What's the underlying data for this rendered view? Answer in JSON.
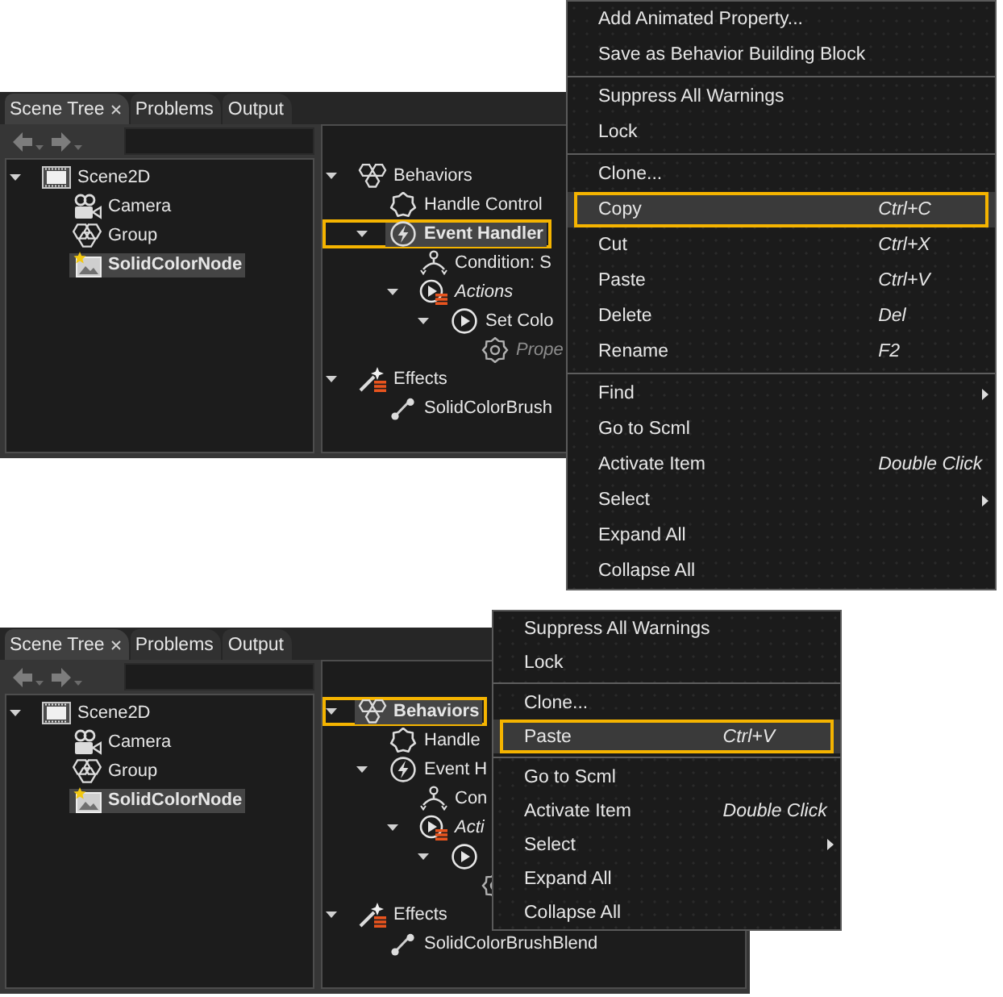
{
  "scenes": [
    {
      "tabs": [
        {
          "label": "Scene Tree",
          "selected": true,
          "closable": true
        },
        {
          "label": "Problems",
          "selected": false,
          "closable": false
        },
        {
          "label": "Output",
          "selected": false,
          "closable": false
        }
      ],
      "scene_tree": [
        {
          "kind": "scene",
          "label": "Scene2D",
          "selected": false,
          "outlined": false,
          "expanded": true,
          "children": [
            {
              "kind": "camera",
              "label": "Camera",
              "selected": false,
              "outlined": false
            },
            {
              "kind": "group",
              "label": "Group",
              "selected": false,
              "outlined": false
            },
            {
              "kind": "image_node",
              "label": "SolidColorNode",
              "selected": true,
              "outlined": false
            }
          ]
        }
      ],
      "behavior_tree": [
        {
          "kind": "behaviors",
          "label": "Behaviors",
          "selected": false,
          "outlined": false,
          "expanded": true,
          "children": [
            {
              "kind": "handle_control",
              "label": "Handle Control",
              "selected": false,
              "outlined": false
            },
            {
              "kind": "event_handler",
              "label": "Event Handler",
              "selected": true,
              "outlined": true,
              "expanded": true,
              "children": [
                {
                  "kind": "condition",
                  "label": "Condition: S",
                  "selected": false,
                  "outlined": false
                },
                {
                  "kind": "actions",
                  "label": "Actions",
                  "selected": false,
                  "outlined": false,
                  "expanded": true,
                  "children": [
                    {
                      "kind": "action",
                      "label": "Set Colo",
                      "selected": false,
                      "outlined": false,
                      "expanded": true,
                      "children": [
                        {
                          "kind": "property",
                          "label": "Prope",
                          "selected": false,
                          "outlined": false
                        }
                      ]
                    }
                  ]
                }
              ]
            }
          ]
        },
        {
          "kind": "effects",
          "label": "Effects",
          "selected": false,
          "outlined": false,
          "expanded": true,
          "children": [
            {
              "kind": "brush",
              "label": "SolidColorBrush",
              "selected": false,
              "outlined": false
            }
          ]
        }
      ],
      "context_menu": {
        "sections": [
          {
            "items": [
              {
                "label": "Add Animated Property...",
                "selected": false,
                "outlined": false,
                "submenu": false
              },
              {
                "label": "Save as Behavior Building Block",
                "selected": false,
                "outlined": false,
                "submenu": false
              }
            ]
          },
          {
            "items": [
              {
                "label": "Suppress All Warnings",
                "selected": false,
                "outlined": false,
                "submenu": false
              },
              {
                "label": "Lock",
                "selected": false,
                "outlined": false,
                "submenu": false
              }
            ]
          },
          {
            "items": [
              {
                "label": "Clone...",
                "selected": false,
                "outlined": false,
                "submenu": false
              },
              {
                "label": "Copy",
                "shortcut": "Ctrl+C",
                "selected": true,
                "outlined": true,
                "submenu": false
              },
              {
                "label": "Cut",
                "shortcut": "Ctrl+X",
                "selected": false,
                "outlined": false,
                "submenu": false
              },
              {
                "label": "Paste",
                "shortcut": "Ctrl+V",
                "selected": false,
                "outlined": false,
                "submenu": false
              },
              {
                "label": "Delete",
                "shortcut": "Del",
                "selected": false,
                "outlined": false,
                "submenu": false
              },
              {
                "label": "Rename",
                "shortcut": "F2",
                "selected": false,
                "outlined": false,
                "submenu": false
              }
            ]
          },
          {
            "items": [
              {
                "label": "Find",
                "selected": false,
                "outlined": false,
                "submenu": true
              },
              {
                "label": "Go to Scml",
                "selected": false,
                "outlined": false,
                "submenu": false
              },
              {
                "label": "Activate Item",
                "shortcut": "Double Click",
                "selected": false,
                "outlined": false,
                "submenu": false
              },
              {
                "label": "Select",
                "selected": false,
                "outlined": false,
                "submenu": true
              },
              {
                "label": "Expand All",
                "selected": false,
                "outlined": false,
                "submenu": false
              },
              {
                "label": "Collapse All",
                "selected": false,
                "outlined": false,
                "submenu": false
              }
            ]
          }
        ]
      }
    },
    {
      "tabs": [
        {
          "label": "Scene Tree",
          "selected": true,
          "closable": true
        },
        {
          "label": "Problems",
          "selected": false,
          "closable": false
        },
        {
          "label": "Output",
          "selected": false,
          "closable": false
        }
      ],
      "scene_tree": [
        {
          "kind": "scene",
          "label": "Scene2D",
          "selected": false,
          "outlined": false,
          "expanded": true,
          "children": [
            {
              "kind": "camera",
              "label": "Camera",
              "selected": false,
              "outlined": false
            },
            {
              "kind": "group",
              "label": "Group",
              "selected": false,
              "outlined": false
            },
            {
              "kind": "image_node",
              "label": "SolidColorNode",
              "selected": true,
              "outlined": false
            }
          ]
        }
      ],
      "behavior_tree": [
        {
          "kind": "behaviors",
          "label": "Behaviors",
          "selected": true,
          "outlined": true,
          "expanded": true,
          "children": [
            {
              "kind": "handle_control",
              "label": "Handle",
              "selected": false,
              "outlined": false
            },
            {
              "kind": "event_handler",
              "label": "Event H",
              "selected": false,
              "outlined": false,
              "expanded": true,
              "children": [
                {
                  "kind": "condition",
                  "label": "Con",
                  "selected": false,
                  "outlined": false
                },
                {
                  "kind": "actions",
                  "label": "Acti",
                  "selected": false,
                  "outlined": false,
                  "expanded": true,
                  "children": [
                    {
                      "kind": "action",
                      "selected": false,
                      "outlined": false,
                      "expanded": true,
                      "children": [
                        {
                          "kind": "property",
                          "selected": false,
                          "outlined": false
                        }
                      ]
                    }
                  ]
                }
              ]
            }
          ]
        },
        {
          "kind": "effects",
          "label": "Effects",
          "selected": false,
          "outlined": false,
          "expanded": true,
          "children": [
            {
              "kind": "brush",
              "label": "SolidColorBrushBlend",
              "selected": false,
              "outlined": false
            }
          ]
        }
      ],
      "context_menu": {
        "sections": [
          {
            "items": [
              {
                "label": "Suppress All Warnings",
                "selected": false,
                "outlined": false,
                "submenu": false
              },
              {
                "label": "Lock",
                "selected": false,
                "outlined": false,
                "submenu": false
              }
            ]
          },
          {
            "items": [
              {
                "label": "Clone...",
                "selected": false,
                "outlined": false,
                "submenu": false
              },
              {
                "label": "Paste",
                "shortcut": "Ctrl+V",
                "selected": true,
                "outlined": true,
                "submenu": false
              }
            ]
          },
          {
            "items": [
              {
                "label": "Go to Scml",
                "selected": false,
                "outlined": false,
                "submenu": false
              },
              {
                "label": "Activate Item",
                "shortcut": "Double Click",
                "selected": false,
                "outlined": false,
                "submenu": false
              },
              {
                "label": "Select",
                "selected": false,
                "outlined": false,
                "submenu": true
              },
              {
                "label": "Expand All",
                "selected": false,
                "outlined": false,
                "submenu": false
              },
              {
                "label": "Collapse All",
                "selected": false,
                "outlined": false,
                "submenu": false
              }
            ]
          }
        ]
      }
    }
  ]
}
